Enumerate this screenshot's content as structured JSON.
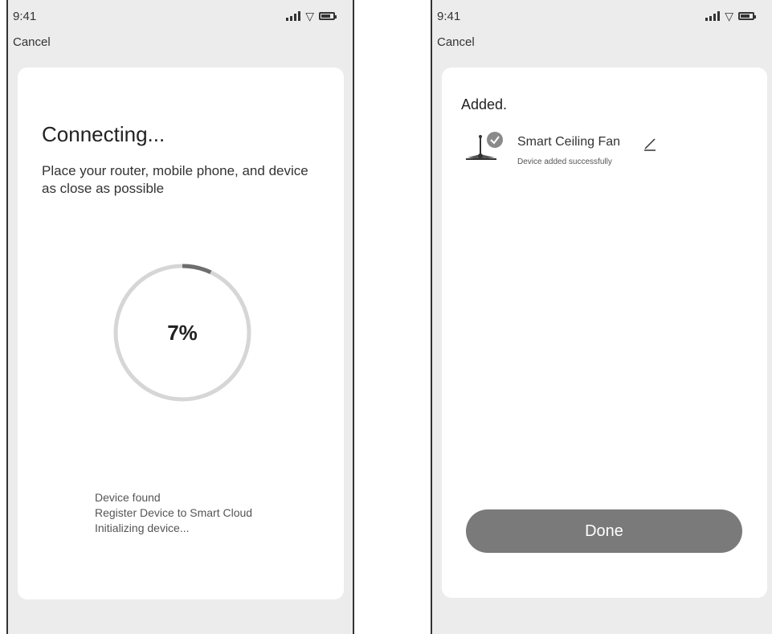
{
  "screens": [
    {
      "status": {
        "time": "9:41"
      },
      "cancel_label": "Cancel",
      "title": "Connecting...",
      "description": "Place your router, mobile phone, and device as close as possible",
      "progress": {
        "percent": 7,
        "label": "7%"
      },
      "steps": [
        "Device found",
        "Register Device to Smart Cloud",
        "Initializing device..."
      ]
    },
    {
      "status": {
        "time": "9:41"
      },
      "cancel_label": "Cancel",
      "title": "Added.",
      "device": {
        "name": "Smart Ceiling Fan",
        "status": "Device added successfully",
        "icon": "ceiling-fan-icon",
        "check_icon": "check-icon",
        "edit_icon": "pencil-icon"
      },
      "done_label": "Done"
    }
  ],
  "colors": {
    "progress_arc": "#6e6e6e",
    "ring_track": "#d6d6d6",
    "done_button": "#7a7a7a",
    "background": "#ececec"
  }
}
